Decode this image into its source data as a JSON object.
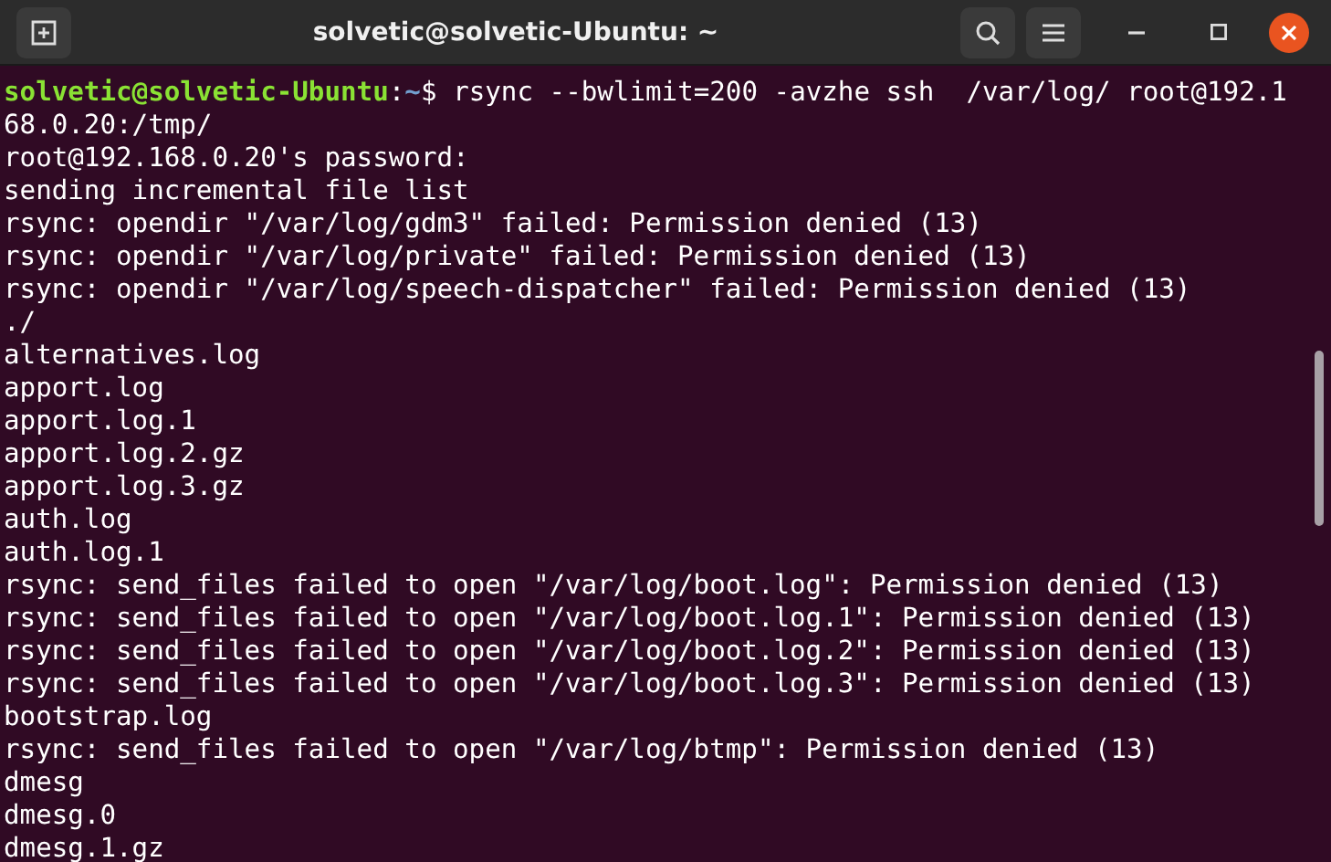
{
  "window": {
    "title": "solvetic@solvetic-Ubuntu: ~"
  },
  "terminal": {
    "lines": [
      {
        "kind": "prompt",
        "user_host": "solvetic@solvetic-Ubuntu",
        "separator": ":",
        "path": "~",
        "symbol": "$",
        "command": "rsync --bwlimit=200 -avzhe ssh  /var/log/ root@192.1"
      },
      {
        "kind": "output",
        "text": "68.0.20:/tmp/"
      },
      {
        "kind": "output",
        "text": "root@192.168.0.20's password:"
      },
      {
        "kind": "output",
        "text": "sending incremental file list"
      },
      {
        "kind": "output",
        "text": "rsync: opendir \"/var/log/gdm3\" failed: Permission denied (13)"
      },
      {
        "kind": "output",
        "text": "rsync: opendir \"/var/log/private\" failed: Permission denied (13)"
      },
      {
        "kind": "output",
        "text": "rsync: opendir \"/var/log/speech-dispatcher\" failed: Permission denied (13)"
      },
      {
        "kind": "output",
        "text": "./"
      },
      {
        "kind": "output",
        "text": "alternatives.log"
      },
      {
        "kind": "output",
        "text": "apport.log"
      },
      {
        "kind": "output",
        "text": "apport.log.1"
      },
      {
        "kind": "output",
        "text": "apport.log.2.gz"
      },
      {
        "kind": "output",
        "text": "apport.log.3.gz"
      },
      {
        "kind": "output",
        "text": "auth.log"
      },
      {
        "kind": "output",
        "text": "auth.log.1"
      },
      {
        "kind": "output",
        "text": "rsync: send_files failed to open \"/var/log/boot.log\": Permission denied (13)"
      },
      {
        "kind": "output",
        "text": "rsync: send_files failed to open \"/var/log/boot.log.1\": Permission denied (13)"
      },
      {
        "kind": "output",
        "text": "rsync: send_files failed to open \"/var/log/boot.log.2\": Permission denied (13)"
      },
      {
        "kind": "output",
        "text": "rsync: send_files failed to open \"/var/log/boot.log.3\": Permission denied (13)"
      },
      {
        "kind": "output",
        "text": "bootstrap.log"
      },
      {
        "kind": "output",
        "text": "rsync: send_files failed to open \"/var/log/btmp\": Permission denied (13)"
      },
      {
        "kind": "output",
        "text": "dmesg"
      },
      {
        "kind": "output",
        "text": "dmesg.0"
      },
      {
        "kind": "output",
        "text": "dmesg.1.gz"
      }
    ]
  }
}
